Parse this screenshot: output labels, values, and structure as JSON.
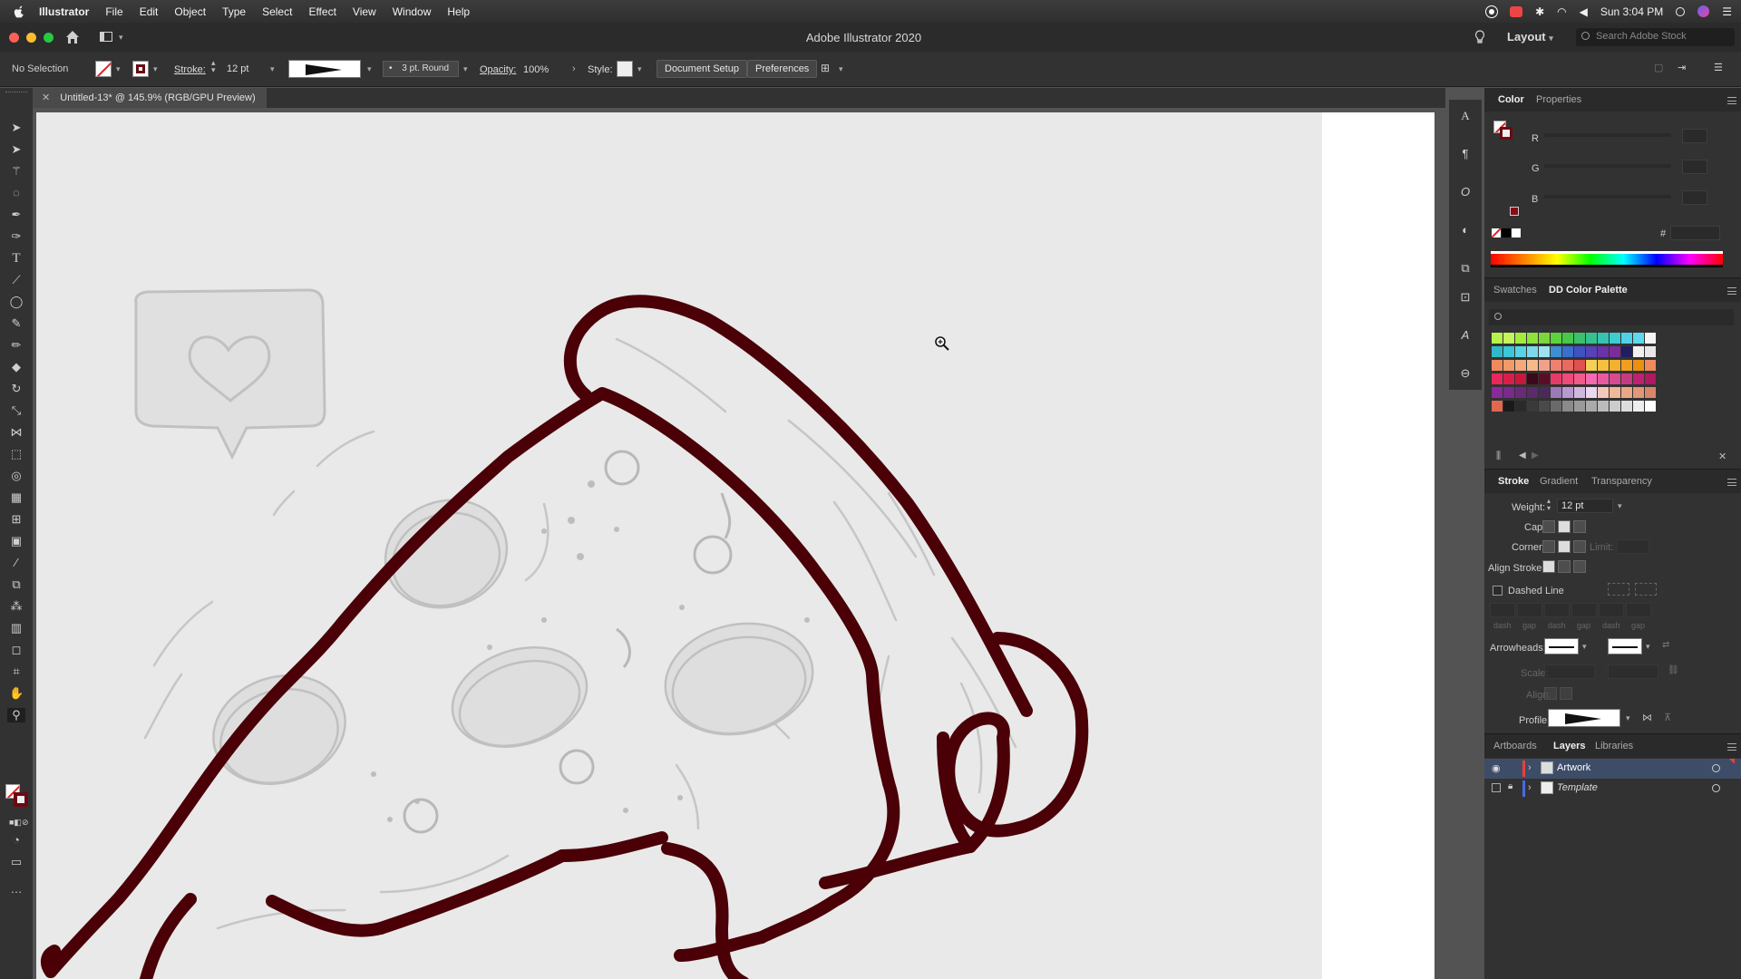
{
  "menubar": {
    "app": "Illustrator",
    "items": [
      "File",
      "Edit",
      "Object",
      "Type",
      "Select",
      "Effect",
      "View",
      "Window",
      "Help"
    ],
    "clock": "Sun 3:04 PM"
  },
  "titlebar": {
    "title": "Adobe Illustrator 2020",
    "layout_label": "Layout",
    "search_placeholder": "Search Adobe Stock"
  },
  "controlbar": {
    "selection": "No Selection",
    "stroke_label": "Stroke:",
    "stroke_value": "12 pt",
    "brush_label": "3 pt. Round",
    "opacity_label": "Opacity:",
    "opacity_value": "100%",
    "style_label": "Style:",
    "document_setup": "Document Setup",
    "preferences": "Preferences"
  },
  "document": {
    "tab_label": "Untitled-13* @ 145.9% (RGB/GPU Preview)"
  },
  "color_panel": {
    "tabs": [
      "Color",
      "Properties"
    ],
    "channels": [
      "R",
      "G",
      "B"
    ],
    "hex_label": "#"
  },
  "swatch_panel": {
    "tabs": [
      "Swatches",
      "DD Color Palette"
    ],
    "swatch_colors": [
      "#b7f24a",
      "#c6f45c",
      "#a4ec3c",
      "#8fe23a",
      "#7dd63c",
      "#5ed23c",
      "#47c84a",
      "#3cc06b",
      "#37c08f",
      "#37c3b0",
      "#3ecbd1",
      "#4fd2e6",
      "#5fd9f0",
      "#f5f5f5",
      "#2fb8c6",
      "#3dc6d6",
      "#58d3e2",
      "#7bdaea",
      "#9ce2f0",
      "#3f8ed1",
      "#3a6fcb",
      "#3e52c2",
      "#5742b8",
      "#6a32a8",
      "#7a2d98",
      "#1f1f5f",
      "#f0f0f0",
      "#e8e8e8",
      "#f08a5a",
      "#f29a6a",
      "#f3a97a",
      "#f6b98a",
      "#f2a08a",
      "#f08070",
      "#e86a60",
      "#e05050",
      "#f2d05a",
      "#f5c040",
      "#f5b030",
      "#f0a020",
      "#ec9010",
      "#f08a5a",
      "#e8285a",
      "#d81e4a",
      "#c81840",
      "#3a0a1a",
      "#5a0e26",
      "#e83a6a",
      "#ee4a7a",
      "#f25a8a",
      "#f26ab0",
      "#e85aa0",
      "#d84a90",
      "#c83a80",
      "#c02070",
      "#b01860",
      "#8a2a9a",
      "#7a2a8a",
      "#6a2a7a",
      "#5a2a6a",
      "#4a2a5a",
      "#9a7ab8",
      "#b89ad0",
      "#d0b8e0",
      "#e8d8f0",
      "#f2c8b8",
      "#f0b898",
      "#eaa888",
      "#e09878",
      "#d88868",
      "#e06850",
      "#1a1a1a",
      "#2a2a2a",
      "#3a3a3a",
      "#4a4a4a",
      "#6a6a6a",
      "#8a8a8a",
      "#9a9a9a",
      "#aaaaaa",
      "#bbbbbb",
      "#cccccc",
      "#dddddd",
      "#eeeeee",
      "#ffffff"
    ]
  },
  "stroke_panel": {
    "tabs": [
      "Stroke",
      "Gradient",
      "Transparency"
    ],
    "weight_label": "Weight:",
    "weight_value": "12 pt",
    "cap_label": "Cap:",
    "corner_label": "Corner:",
    "limit_label": "Limit:",
    "align_label": "Align Stroke:",
    "dashed_label": "Dashed Line",
    "dash_labels": [
      "dash",
      "gap",
      "dash",
      "gap",
      "dash",
      "gap"
    ],
    "arrowheads_label": "Arrowheads:",
    "scale_label": "Scale:",
    "align2_label": "Align:",
    "profile_label": "Profile:"
  },
  "layers_panel": {
    "tabs": [
      "Artboards",
      "Layers",
      "Libraries"
    ],
    "layers": [
      {
        "name": "Artwork",
        "color": "#e8403a"
      },
      {
        "name": "Template",
        "color": "#4a6ae0"
      }
    ]
  },
  "colors": {
    "stroke": "#4a0006",
    "sketch": "#b8b8b8"
  }
}
